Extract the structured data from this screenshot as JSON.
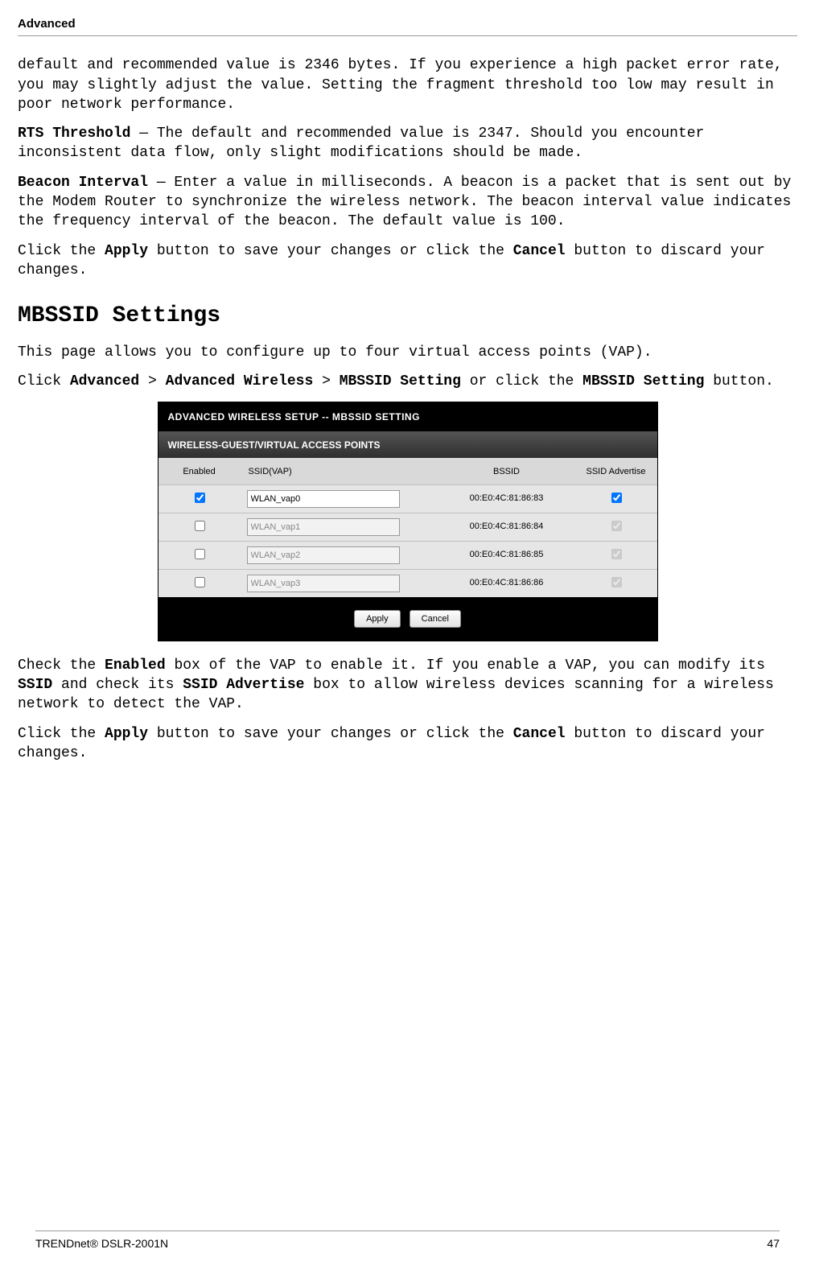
{
  "header": {
    "title": "Advanced"
  },
  "intro": {
    "frag_text": "default and recommended value is 2346 bytes. If you experience a high packet error rate, you may slightly adjust the value. Setting the fragment threshold too low may result in poor network performance.",
    "rts_label": "RTS Threshold",
    "rts_text": " — The default and recommended value is 2347. Should you encounter inconsistent data flow, only slight modifications should be made.",
    "beacon_label": "Beacon Interval",
    "beacon_text": " — Enter a value in milliseconds. A beacon is a packet that is sent out by the Modem Router to synchronize the wireless network. The beacon interval value indicates the frequency interval of the beacon. The default value is 100.",
    "apply_a": "Click the ",
    "apply_b": "Apply",
    "apply_c": " button to save your changes or click the ",
    "apply_d": "Cancel",
    "apply_e": " button to discard your changes."
  },
  "section_heading": "MBSSID Settings",
  "mbssid_intro": "This page allows you to configure up to four virtual access points (VAP).",
  "nav_a": "Click ",
  "nav_b": "Advanced",
  "nav_c": " > ",
  "nav_d": "Advanced Wireless",
  "nav_e": " > ",
  "nav_f": "MBSSID Setting",
  "nav_g": " or click the ",
  "nav_h": "MBSSID Setting",
  "nav_i": " button.",
  "screenshot": {
    "panel_title": "ADVANCED WIRELESS SETUP -- MBSSID SETTING",
    "sub_title": "WIRELESS-GUEST/VIRTUAL ACCESS POINTS",
    "cols": {
      "enabled": "Enabled",
      "ssid": "SSID(VAP)",
      "bssid": "BSSID",
      "adv": "SSID Advertise"
    },
    "rows": [
      {
        "enabled": true,
        "ssid": "WLAN_vap0",
        "bssid": "00:E0:4C:81:86:83",
        "adv": true,
        "editable": true
      },
      {
        "enabled": false,
        "ssid": "WLAN_vap1",
        "bssid": "00:E0:4C:81:86:84",
        "adv": true,
        "editable": false
      },
      {
        "enabled": false,
        "ssid": "WLAN_vap2",
        "bssid": "00:E0:4C:81:86:85",
        "adv": true,
        "editable": false
      },
      {
        "enabled": false,
        "ssid": "WLAN_vap3",
        "bssid": "00:E0:4C:81:86:86",
        "adv": true,
        "editable": false
      }
    ],
    "apply_btn": "Apply",
    "cancel_btn": "Cancel"
  },
  "after1_a": "Check the ",
  "after1_b": "Enabled",
  "after1_c": " box of the VAP to enable it. If you enable a VAP, you can modify its ",
  "after1_d": "SSID",
  "after1_e": " and check its ",
  "after1_f": "SSID Advertise",
  "after1_g": " box to allow wireless devices scanning for a wireless network to detect the VAP.",
  "after2_a": "Click the ",
  "after2_b": "Apply",
  "after2_c": " button to save your changes or click the ",
  "after2_d": "Cancel",
  "after2_e": " button to discard your changes.",
  "footer": {
    "left": "TRENDnet® DSLR-2001N",
    "right": "47"
  }
}
